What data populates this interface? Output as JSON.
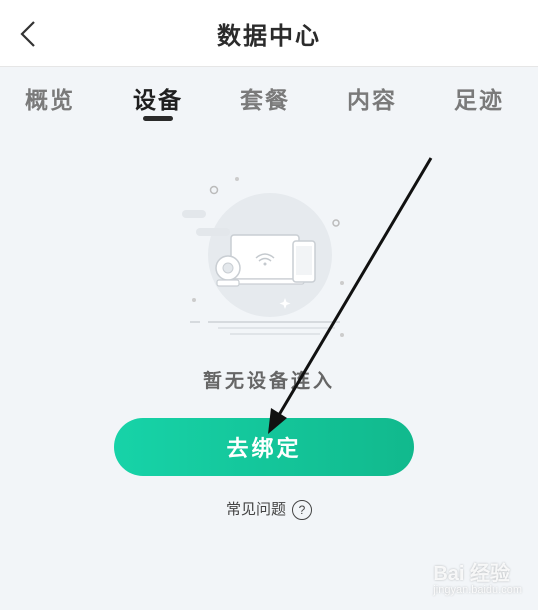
{
  "header": {
    "title": "数据中心"
  },
  "tabs": [
    {
      "label": "概览"
    },
    {
      "label": "设备"
    },
    {
      "label": "套餐"
    },
    {
      "label": "内容"
    },
    {
      "label": "足迹"
    }
  ],
  "active_tab": "设备",
  "empty_state": {
    "message": "暂无设备连入",
    "button_label": "去绑定",
    "faq_label": "常见问题",
    "faq_icon": "?"
  },
  "watermark": {
    "brand": "Bai 经验",
    "sub": "jingyan.baidu.com"
  },
  "colors": {
    "accent": "#15c79b",
    "background": "#f2f5f8"
  }
}
